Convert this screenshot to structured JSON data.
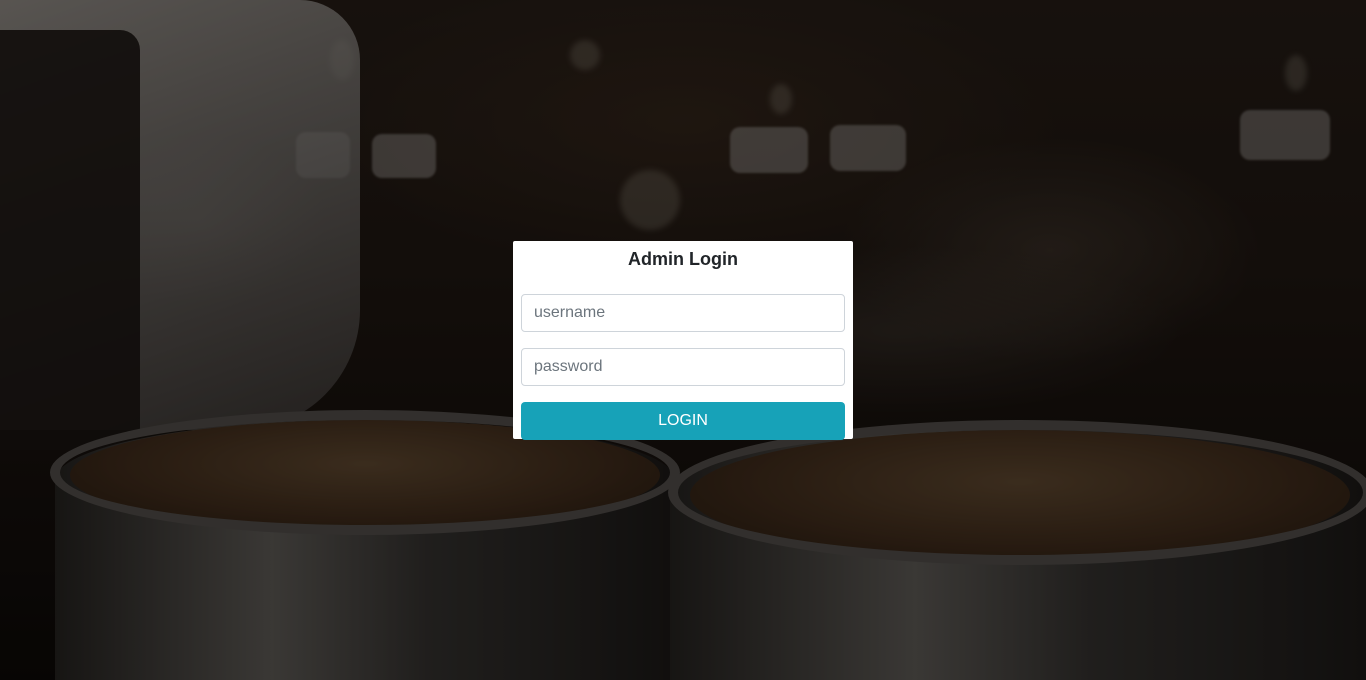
{
  "login": {
    "title": "Admin Login",
    "username_placeholder": "username",
    "username_value": "",
    "password_placeholder": "password",
    "password_value": "",
    "button_label": "LOGIN"
  },
  "colors": {
    "button": "#17a2b8",
    "card": "#ffffff",
    "overlay": "rgba(0,0,0,0.45)"
  }
}
